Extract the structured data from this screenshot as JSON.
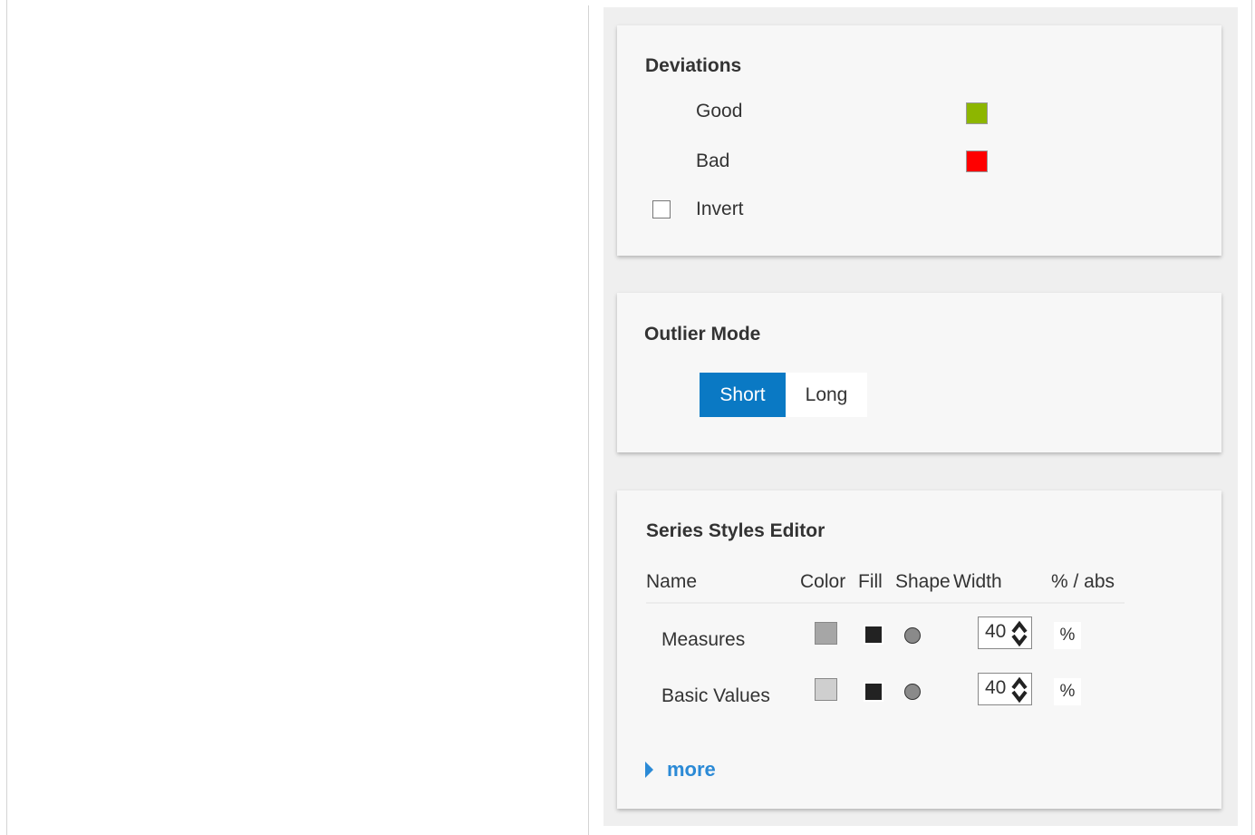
{
  "deviations": {
    "title": "Deviations",
    "good_label": "Good",
    "good_color": "#8db600",
    "bad_label": "Bad",
    "bad_color": "#ff0000",
    "invert_label": "Invert",
    "invert_checked": false
  },
  "outlier_mode": {
    "title": "Outlier Mode",
    "options": [
      "Short",
      "Long"
    ],
    "selected": "Short",
    "active_color": "#0a79c4"
  },
  "series_styles": {
    "title": "Series Styles Editor",
    "headers": {
      "name": "Name",
      "color": "Color",
      "fill": "Fill",
      "shape": "Shape",
      "width": "Width",
      "unit": "% / abs"
    },
    "rows": [
      {
        "name": "Measures",
        "color": "#a6a6a6",
        "fill": "filled-square",
        "shape": "circle",
        "width": "40",
        "unit": "%"
      },
      {
        "name": "Basic Values",
        "color": "#cfcfcf",
        "fill": "filled-square",
        "shape": "circle",
        "width": "40",
        "unit": "%"
      }
    ],
    "more_label": "more"
  }
}
